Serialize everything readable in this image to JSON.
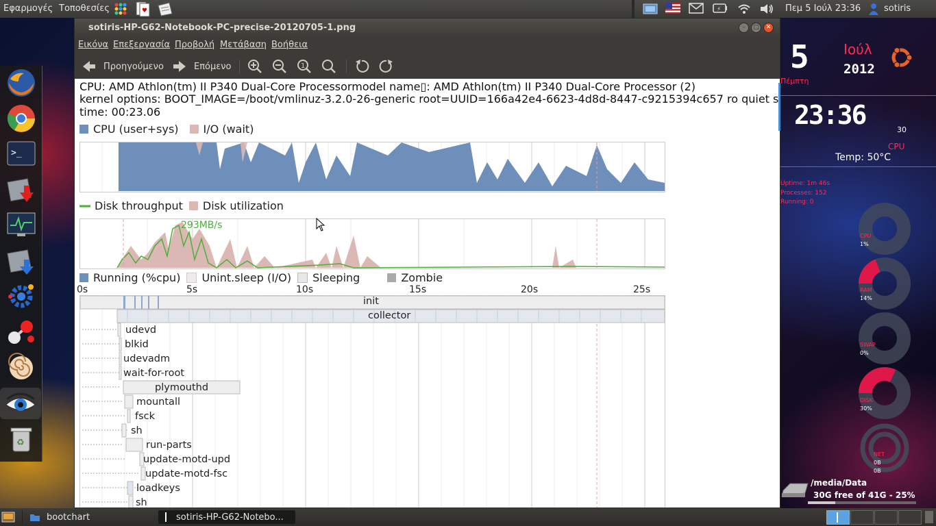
{
  "top_panel": {
    "menus": [
      "Εφαρμογές",
      "Τοποθεσίες"
    ],
    "datetime": "Πεμ  5 Ιούλ 23:36",
    "user": "sotiris"
  },
  "window": {
    "title": "sotiris-HP-G62-Notebook-PC-precise-20120705-1.png",
    "menu": [
      "Εικόνα",
      "Επεξεργασία",
      "Προβολή",
      "Μετάβαση",
      "Βοήθεια"
    ],
    "toolbar": {
      "prev_label": "Προηγούμενο",
      "next_label": "Επόμενο"
    }
  },
  "bootchart": {
    "cpu_line": "CPU: AMD Athlon(tm) II P340 Dual-Core Processormodel name▯: AMD Athlon(tm) II P340 Dual-Core Processor (2)",
    "kernel_line": "kernel options: BOOT_IMAGE=/boot/vmlinuz-3.2.0-26-generic root=UUID=166a42e4-6623-4d8d-8447-c9215394c657 ro quiet sp",
    "time_line": "time: 00:23.06",
    "cpu_legend": [
      "CPU (user+sys)",
      "I/O (wait)"
    ],
    "disk_legend": [
      "Disk throughput",
      "Disk utilization"
    ],
    "disk_peak_label": "293MB/s",
    "proc_legend": [
      "Running (%cpu)",
      "Unint.sleep (I/O)",
      "Sleeping",
      "Zombie"
    ],
    "time_ticks": [
      "0s",
      "5s",
      "10s",
      "15s",
      "20s",
      "25s"
    ],
    "processes": [
      {
        "name": "init"
      },
      {
        "name": "collector"
      },
      {
        "name": "udevd"
      },
      {
        "name": "blkid"
      },
      {
        "name": "udevadm"
      },
      {
        "name": "wait-for-root"
      },
      {
        "name": "plymouthd"
      },
      {
        "name": "mountall"
      },
      {
        "name": "fsck"
      },
      {
        "name": "sh"
      },
      {
        "name": "run-parts"
      },
      {
        "name": "update-motd-upd"
      },
      {
        "name": "update-motd-fsc"
      },
      {
        "name": "loadkeys"
      },
      {
        "name": "sh"
      }
    ],
    "colors": {
      "cpu": "#6e8fba",
      "io": "#dcb8b4",
      "disk_line": "#4caf3a",
      "sleep": "#e8e8e8"
    }
  },
  "conky": {
    "day": "5",
    "month": "Ιούλ",
    "year": "2012",
    "weekday": "Πέμπτη",
    "time": "23:36",
    "seconds": "30",
    "cpu_title": "CPU",
    "temp": "Temp: 50°C",
    "uptime": "Uptime: 1m 46s",
    "processes": "Processes: 152",
    "running": "Running: 0",
    "cpu_label": "CPU",
    "cpu_val": "1%",
    "ram_label": "RAM",
    "ram_val": "14%",
    "swap_label": "SWAP",
    "swap_val": "0%",
    "disk_label": "DISK",
    "disk_val": "30%",
    "net_label": "NET",
    "net_up": "0B",
    "net_down": "0B",
    "drive_path": "/media/Data",
    "drive_free": "30G free of 41G - 25%"
  },
  "bottom_panel": {
    "tasks": [
      "bootchart",
      "sotiris-HP-G62-Notebo..."
    ]
  }
}
